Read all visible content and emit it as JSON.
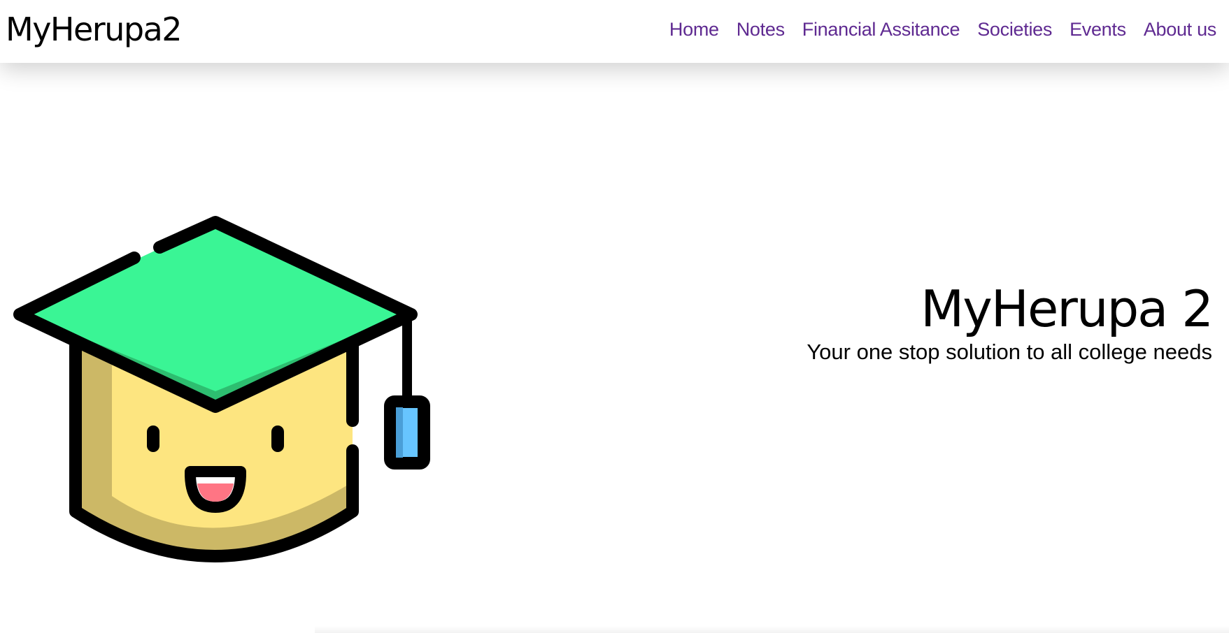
{
  "brand": {
    "name": "MyHerupa2"
  },
  "nav": {
    "items": [
      {
        "label": "Home"
      },
      {
        "label": "Notes"
      },
      {
        "label": "Financial Assitance"
      },
      {
        "label": "Societies"
      },
      {
        "label": "Events"
      },
      {
        "label": "About us"
      }
    ]
  },
  "hero": {
    "title": "MyHerupa 2",
    "subtitle": "Your one stop solution to all college needs",
    "illustration": "graduation-cap-face-icon"
  },
  "colors": {
    "nav_link": "#5f2a91",
    "cap_top": "#3af595",
    "cap_shade": "#2dbe70",
    "face": "#fde580",
    "face_shade": "#ccb866",
    "tongue": "#ff7584",
    "tassel": "#67c5ff",
    "tassel_shade": "#4a9fd8",
    "outline": "#000000"
  }
}
